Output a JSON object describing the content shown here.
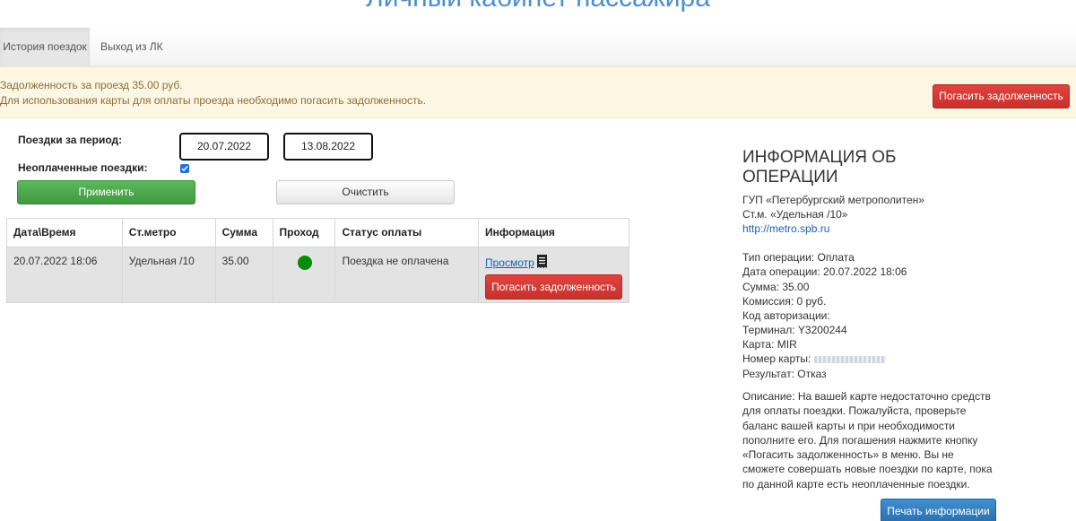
{
  "page": {
    "title": "Личный кабинет пассажира"
  },
  "nav": {
    "tabs": [
      {
        "label": "История поездок"
      },
      {
        "label": "Выход из ЛК"
      }
    ]
  },
  "alert": {
    "line1": "Задолженность за проезд 35.00 руб.",
    "line2": "Для использования карты для оплаты проезда необходимо погасить задолженность.",
    "button": "Погасить задолженность"
  },
  "filter": {
    "period_label": "Поездки за период:",
    "date_from": "20.07.2022",
    "date_to": "13.08.2022",
    "unpaid_label": "Неоплаченные поездки:",
    "unpaid_checked": true,
    "apply": "Применить",
    "clear": "Очистить"
  },
  "table": {
    "headers": [
      "Дата\\Время",
      "Ст.метро",
      "Сумма",
      "Проход",
      "Статус оплаты",
      "Информация"
    ],
    "rows": [
      {
        "datetime": "20.07.2022 18:06",
        "station": "Удельная /10",
        "sum": "35.00",
        "status": "Поездка не оплачена",
        "view": "Просмотр",
        "pay": "Погасить задолженность"
      }
    ]
  },
  "info": {
    "title": "ИНФОРМАЦИЯ ОБ ОПЕРАЦИИ",
    "org": "ГУП «Петербургский метрополитен»",
    "station": "Ст.м. «Удельная /10»",
    "link": "http://metro.spb.ru",
    "op_type": "Тип операции: Оплата",
    "op_date": "Дата операции: 20.07.2022 18:06",
    "sum": "Сумма: 35.00",
    "fee": "Комиссия: 0 руб.",
    "auth": "Код авторизации:",
    "terminal": "Терминал: Y3200244",
    "card": "Карта: MIR",
    "card_number_label": "Номер карты:",
    "result": "Результат: Отказ",
    "description": "Описание: На вашей карте недостаточно средств для оплаты поездки. Пожалуйста, проверьте баланс вашей карты и при необходимости пополните его. Для погашения нажмите кнопку «Погасить задолженность» в меню. Вы не сможете совершать новые поездки по карте, пока по данной карте есть неоплаченные поездки.",
    "print": "Печать информации"
  }
}
